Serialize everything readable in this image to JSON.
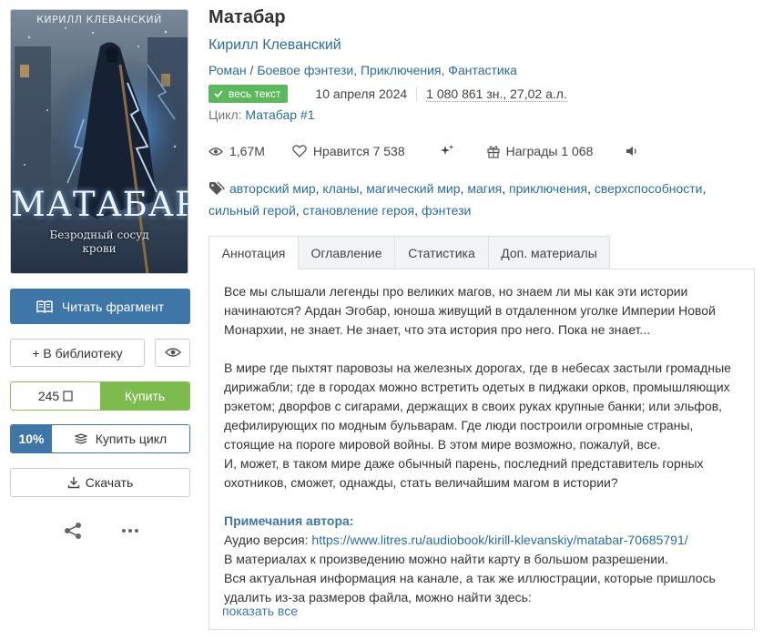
{
  "cover": {
    "author": "КИРИЛЛ КЛЕВАНСКИЙ",
    "title": "МАТАБАР",
    "subtitle": "Безродный сосуд крови"
  },
  "actions": {
    "read_fragment": "Читать фрагмент",
    "add_library": "+ В библиотеку",
    "price": "245",
    "currency_icon": "ruble-icon",
    "buy": "Купить",
    "cycle_discount": "10%",
    "buy_cycle": "Купить цикл",
    "download": "Скачать"
  },
  "book": {
    "title": "Матабар",
    "author": "Кирилл Клеванский",
    "genres": [
      "Роман",
      "Боевое фэнтези",
      "Приключения",
      "Фантастика"
    ],
    "status_badge": "весь текст",
    "date": "10 апреля 2024",
    "size": "1 080 861 зн., 27,02 а.л.",
    "cycle_label": "Цикл:",
    "cycle_name": "Матабар #1"
  },
  "stats": {
    "views": "1,67M",
    "likes_label": "Нравится",
    "likes": "7 538",
    "awards_label": "Награды",
    "awards": "1 068"
  },
  "tags": [
    "авторский мир",
    "кланы",
    "магический мир",
    "магия",
    "приключения",
    "сверхспособности",
    "сильный герой",
    "становление героя",
    "фэнтези"
  ],
  "tabs": [
    {
      "label": "Аннотация",
      "active": true
    },
    {
      "label": "Оглавление",
      "active": false
    },
    {
      "label": "Статистика",
      "active": false
    },
    {
      "label": "Доп. материалы",
      "active": false
    }
  ],
  "annotation": {
    "p1": "Все мы слышали легенды про великих магов, но знаем ли мы как эти истории начинаются? Ардан Эгобар, юноша живущий в отдаленном уголке Империи Новой Монархии, не знает. Не знает, что эта история про него. Пока не знает...",
    "p2": "В мире где пыхтят паровозы на железных дорогах, где в небесах застыли громадные дирижабли; где в городах можно встретить одетых в пиджаки орков, промышляющих рэкетом; дворфов с сигарами, держащих в своих руках крупные банки; или эльфов, дефилирующих по модным бульварам. Где люди построили огромные страны, стоящие на пороге мировой войны. В этом мире возможно, пожалуй, все.",
    "p3": "И, может, в таком мире даже обычный парень, последний представитель горных охотников, сможет, однажды, стать величайшим магом в истории?",
    "notes_title": "Примечания автора:",
    "audio_label": "Аудио версия:",
    "audio_link": "https://www.litres.ru/audiobook/kirill-klevanskiy/matabar-70685791/",
    "note2": "В материалах к произведению можно найти карту в большом разрешении.",
    "note3": "Вся актуальная информация на канале, а так же иллюстрации, которые пришлось удалить из-за размеров файла, можно найти здесь:",
    "show_all": "показать все"
  },
  "colors": {
    "primary": "#3f76a8",
    "buy_green": "#7dbb4f",
    "badge_green": "#5cb85c",
    "link": "#2b6ca3"
  }
}
